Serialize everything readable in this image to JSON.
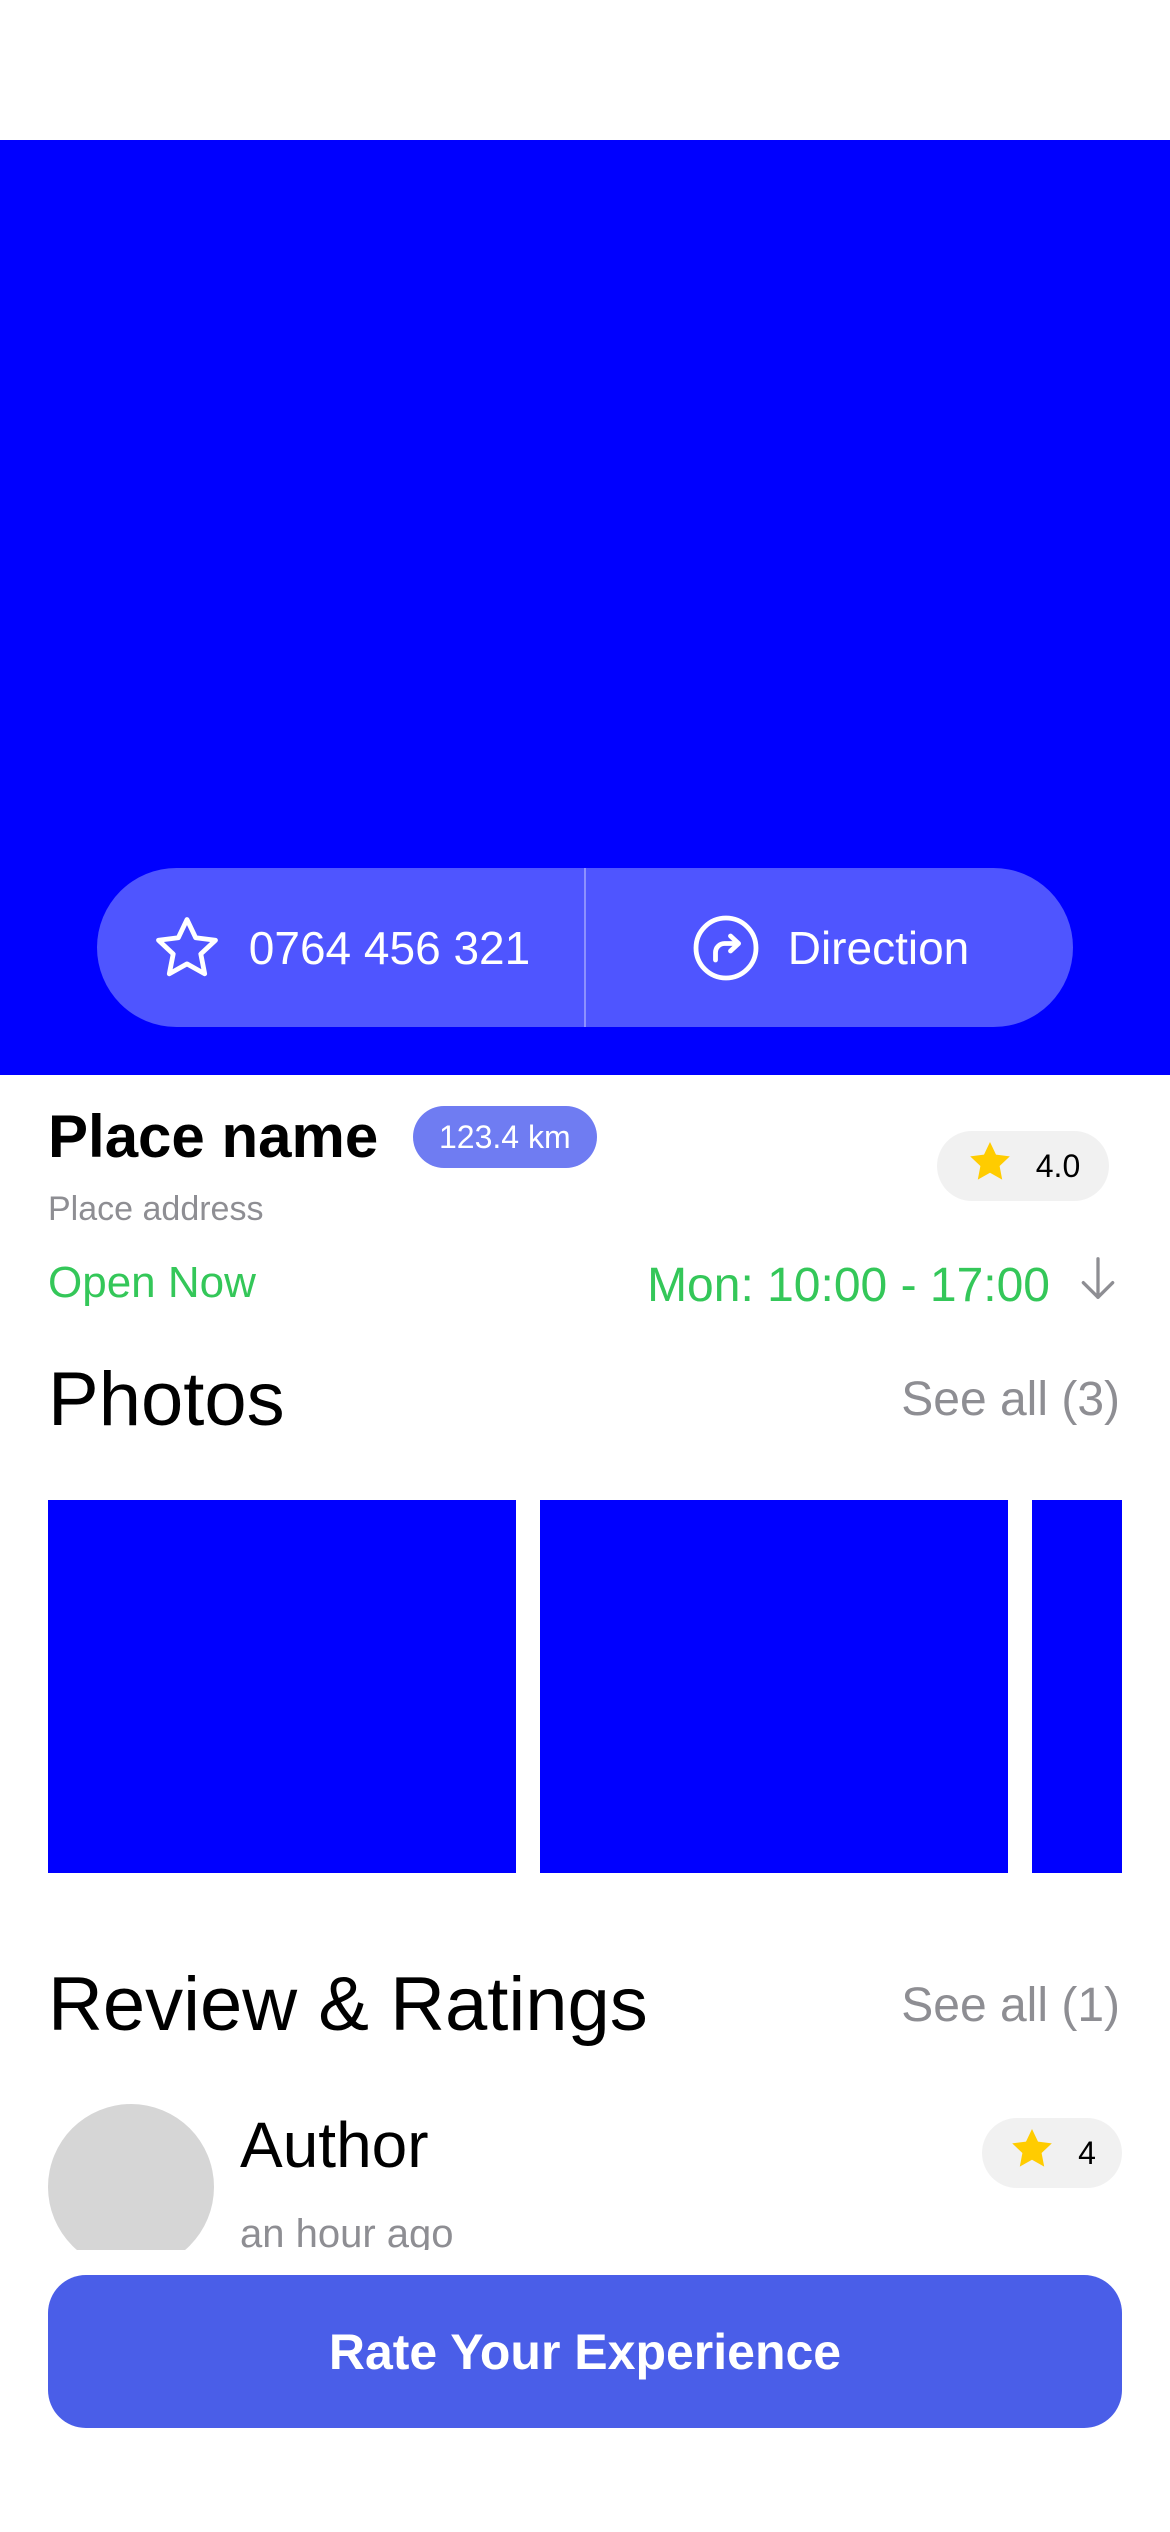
{
  "actions": {
    "phone": "0764 456 321",
    "direction": "Direction"
  },
  "place": {
    "name": "Place name",
    "distance": "123.4 km",
    "rating": "4.0",
    "address": "Place address",
    "status": "Open Now",
    "hours": "Mon: 10:00 - 17:00"
  },
  "photos": {
    "title": "Photos",
    "see_all": "See all (3)"
  },
  "reviews": {
    "title": "Review & Ratings",
    "see_all": "See all (1)",
    "items": [
      {
        "author": "Author",
        "time": "an hour ago",
        "rating": "4"
      }
    ]
  },
  "cta": {
    "label": "Rate Your Experience"
  },
  "colors": {
    "hero": "#0000ff",
    "accent": "#4a5ee8",
    "open": "#34c759",
    "star": "#ffcc00"
  },
  "icons": [
    "star-outline-icon",
    "direction-icon",
    "star-filled-icon",
    "arrow-down-icon"
  ]
}
